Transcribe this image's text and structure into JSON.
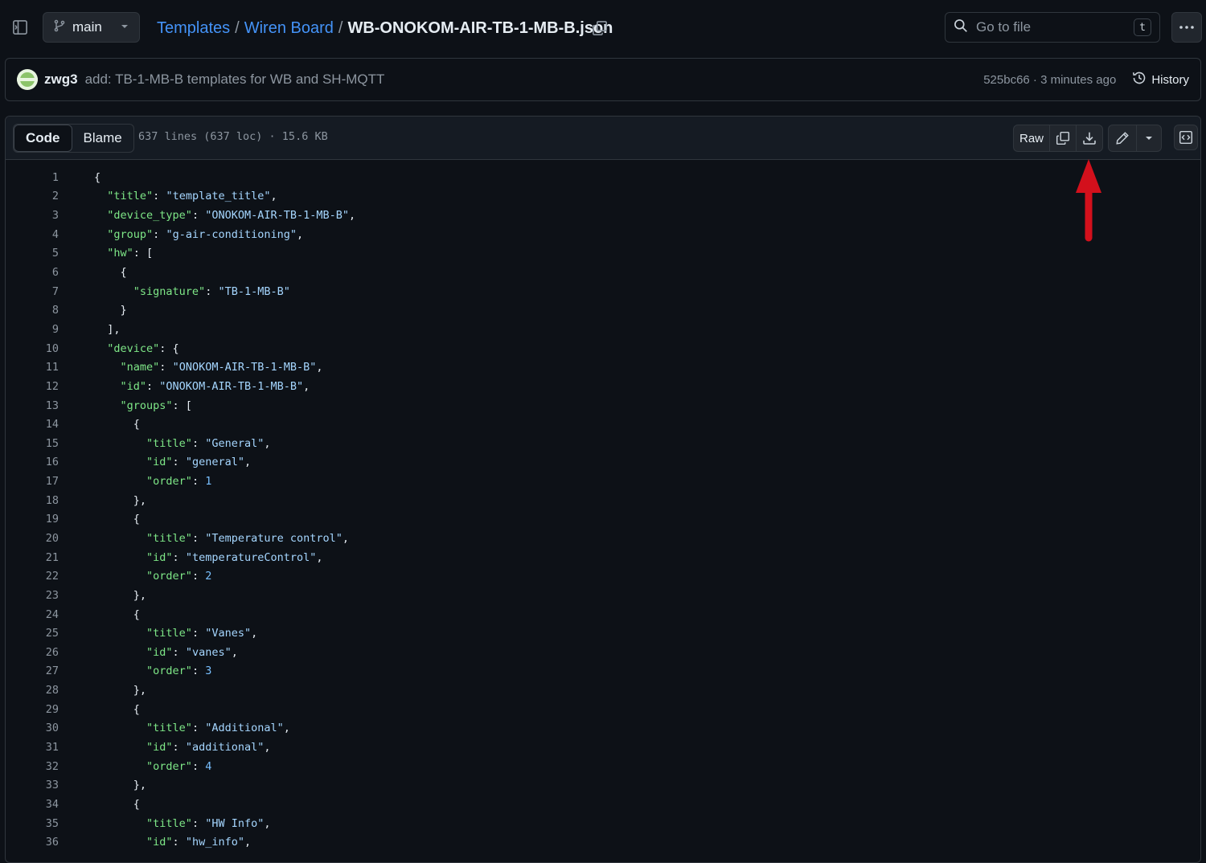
{
  "header": {
    "branch": "main",
    "breadcrumb": {
      "root": "Templates",
      "folder": "Wiren Board",
      "separator": "/",
      "file": "WB-ONOKOM-AIR-TB-1-MB-B.json"
    },
    "search_placeholder": "Go to file",
    "search_shortcut": "t"
  },
  "commit": {
    "author": "zwg3",
    "message": "add: TB-1-MB-B templates for WB and SH-MQTT",
    "meta": "525bc66 · 3 minutes ago",
    "history_label": "History"
  },
  "file": {
    "tab_code": "Code",
    "tab_blame": "Blame",
    "info": "637 lines (637 loc) · 15.6 KB",
    "raw_label": "Raw"
  },
  "code_lines": [
    [
      [
        "p",
        "{"
      ]
    ],
    [
      [
        "p",
        "  "
      ],
      [
        "k",
        "\"title\""
      ],
      [
        "p",
        ": "
      ],
      [
        "s",
        "\"template_title\""
      ],
      [
        "p",
        ","
      ]
    ],
    [
      [
        "p",
        "  "
      ],
      [
        "k",
        "\"device_type\""
      ],
      [
        "p",
        ": "
      ],
      [
        "s",
        "\"ONOKOM-AIR-TB-1-MB-B\""
      ],
      [
        "p",
        ","
      ]
    ],
    [
      [
        "p",
        "  "
      ],
      [
        "k",
        "\"group\""
      ],
      [
        "p",
        ": "
      ],
      [
        "s",
        "\"g-air-conditioning\""
      ],
      [
        "p",
        ","
      ]
    ],
    [
      [
        "p",
        "  "
      ],
      [
        "k",
        "\"hw\""
      ],
      [
        "p",
        ": ["
      ]
    ],
    [
      [
        "p",
        "    {"
      ]
    ],
    [
      [
        "p",
        "      "
      ],
      [
        "k",
        "\"signature\""
      ],
      [
        "p",
        ": "
      ],
      [
        "s",
        "\"TB-1-MB-B\""
      ]
    ],
    [
      [
        "p",
        "    }"
      ]
    ],
    [
      [
        "p",
        "  ],"
      ]
    ],
    [
      [
        "p",
        "  "
      ],
      [
        "k",
        "\"device\""
      ],
      [
        "p",
        ": {"
      ]
    ],
    [
      [
        "p",
        "    "
      ],
      [
        "k",
        "\"name\""
      ],
      [
        "p",
        ": "
      ],
      [
        "s",
        "\"ONOKOM-AIR-TB-1-MB-B\""
      ],
      [
        "p",
        ","
      ]
    ],
    [
      [
        "p",
        "    "
      ],
      [
        "k",
        "\"id\""
      ],
      [
        "p",
        ": "
      ],
      [
        "s",
        "\"ONOKOM-AIR-TB-1-MB-B\""
      ],
      [
        "p",
        ","
      ]
    ],
    [
      [
        "p",
        "    "
      ],
      [
        "k",
        "\"groups\""
      ],
      [
        "p",
        ": ["
      ]
    ],
    [
      [
        "p",
        "      {"
      ]
    ],
    [
      [
        "p",
        "        "
      ],
      [
        "k",
        "\"title\""
      ],
      [
        "p",
        ": "
      ],
      [
        "s",
        "\"General\""
      ],
      [
        "p",
        ","
      ]
    ],
    [
      [
        "p",
        "        "
      ],
      [
        "k",
        "\"id\""
      ],
      [
        "p",
        ": "
      ],
      [
        "s",
        "\"general\""
      ],
      [
        "p",
        ","
      ]
    ],
    [
      [
        "p",
        "        "
      ],
      [
        "k",
        "\"order\""
      ],
      [
        "p",
        ": "
      ],
      [
        "n",
        "1"
      ]
    ],
    [
      [
        "p",
        "      },"
      ]
    ],
    [
      [
        "p",
        "      {"
      ]
    ],
    [
      [
        "p",
        "        "
      ],
      [
        "k",
        "\"title\""
      ],
      [
        "p",
        ": "
      ],
      [
        "s",
        "\"Temperature control\""
      ],
      [
        "p",
        ","
      ]
    ],
    [
      [
        "p",
        "        "
      ],
      [
        "k",
        "\"id\""
      ],
      [
        "p",
        ": "
      ],
      [
        "s",
        "\"temperatureControl\""
      ],
      [
        "p",
        ","
      ]
    ],
    [
      [
        "p",
        "        "
      ],
      [
        "k",
        "\"order\""
      ],
      [
        "p",
        ": "
      ],
      [
        "n",
        "2"
      ]
    ],
    [
      [
        "p",
        "      },"
      ]
    ],
    [
      [
        "p",
        "      {"
      ]
    ],
    [
      [
        "p",
        "        "
      ],
      [
        "k",
        "\"title\""
      ],
      [
        "p",
        ": "
      ],
      [
        "s",
        "\"Vanes\""
      ],
      [
        "p",
        ","
      ]
    ],
    [
      [
        "p",
        "        "
      ],
      [
        "k",
        "\"id\""
      ],
      [
        "p",
        ": "
      ],
      [
        "s",
        "\"vanes\""
      ],
      [
        "p",
        ","
      ]
    ],
    [
      [
        "p",
        "        "
      ],
      [
        "k",
        "\"order\""
      ],
      [
        "p",
        ": "
      ],
      [
        "n",
        "3"
      ]
    ],
    [
      [
        "p",
        "      },"
      ]
    ],
    [
      [
        "p",
        "      {"
      ]
    ],
    [
      [
        "p",
        "        "
      ],
      [
        "k",
        "\"title\""
      ],
      [
        "p",
        ": "
      ],
      [
        "s",
        "\"Additional\""
      ],
      [
        "p",
        ","
      ]
    ],
    [
      [
        "p",
        "        "
      ],
      [
        "k",
        "\"id\""
      ],
      [
        "p",
        ": "
      ],
      [
        "s",
        "\"additional\""
      ],
      [
        "p",
        ","
      ]
    ],
    [
      [
        "p",
        "        "
      ],
      [
        "k",
        "\"order\""
      ],
      [
        "p",
        ": "
      ],
      [
        "n",
        "4"
      ]
    ],
    [
      [
        "p",
        "      },"
      ]
    ],
    [
      [
        "p",
        "      {"
      ]
    ],
    [
      [
        "p",
        "        "
      ],
      [
        "k",
        "\"title\""
      ],
      [
        "p",
        ": "
      ],
      [
        "s",
        "\"HW Info\""
      ],
      [
        "p",
        ","
      ]
    ],
    [
      [
        "p",
        "        "
      ],
      [
        "k",
        "\"id\""
      ],
      [
        "p",
        ": "
      ],
      [
        "s",
        "\"hw_info\""
      ],
      [
        "p",
        ","
      ]
    ]
  ],
  "colors": {
    "background": "#0d1117",
    "link": "#4493f8",
    "json_key": "#7ee787",
    "json_string": "#a5d6ff",
    "json_number": "#79c0ff",
    "annotation_arrow": "#d3101c"
  },
  "icons": [
    "sidebar-toggle-icon",
    "branch-icon",
    "caret-down-icon",
    "copy-icon",
    "search-icon",
    "kebab-icon",
    "history-icon",
    "download-icon",
    "pencil-icon",
    "symbols-icon"
  ]
}
